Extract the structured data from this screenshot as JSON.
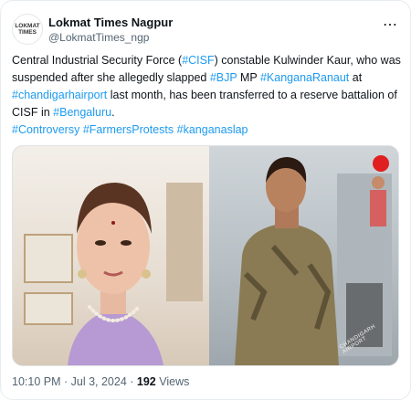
{
  "tweet": {
    "display_name": "Lokmat Times Nagpur",
    "handle": "@LokmatTimes_ngp",
    "avatar_text": "LOKMAT TIMES",
    "more_label": "⋯",
    "text": {
      "t1": "Central Industrial Security Force (",
      "h_cisf": "#CISF",
      "t2": ") constable Kulwinder Kaur, who was suspended after she allegedly slapped ",
      "h_bjp": "#BJP",
      "t3": " MP ",
      "h_kangana": "#KanganaRanaut",
      "t4": " at ",
      "h_airport": "#chandigarhairport",
      "t5": " last month, has been transferred to a reserve battalion of CISF in ",
      "h_bengaluru": "#Bengaluru",
      "t6": ".",
      "h_controversy": "#Controversy",
      "h_farmers": "#FarmersProtests",
      "h_slap": "#kanganaslap"
    },
    "media": {
      "overlay_text": "CHANDIGARH AIRPORT"
    },
    "meta": {
      "time": "10:10 PM · Jul 3, 2024 · ",
      "views_count": "192",
      "views_label": " Views"
    }
  }
}
